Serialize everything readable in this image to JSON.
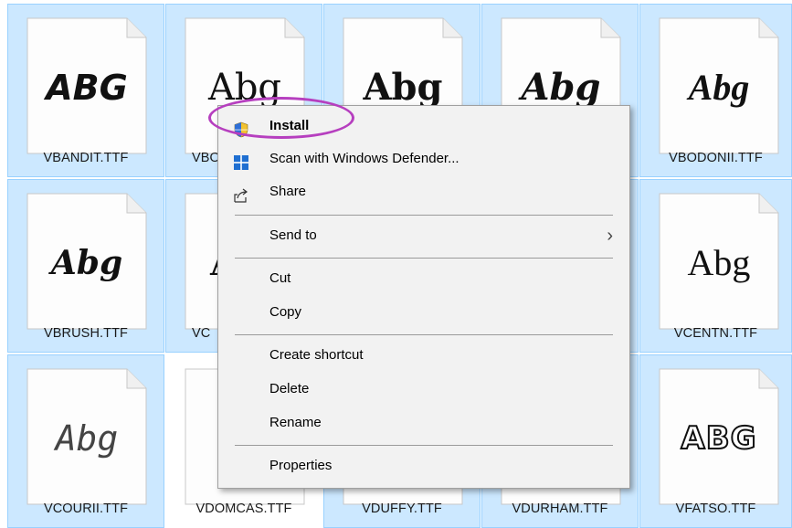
{
  "files": [
    {
      "name": "VBANDIT.TTF",
      "sample": "ABG",
      "selected": true
    },
    {
      "name": "VBO",
      "sample": "Abg",
      "selected": true
    },
    {
      "name": "",
      "sample": "Abg",
      "selected": true
    },
    {
      "name": "",
      "sample": "Abg",
      "selected": true
    },
    {
      "name": "VBODONII.TTF",
      "sample": "Abg",
      "selected": true
    },
    {
      "name": "VBRUSH.TTF",
      "sample": "Abg",
      "selected": true
    },
    {
      "name": "VC",
      "sample": "A",
      "selected": true
    },
    {
      "name": "",
      "sample": "",
      "selected": true
    },
    {
      "name": "",
      "sample": "",
      "selected": true
    },
    {
      "name": "VCENTN.TTF",
      "sample": "Abg",
      "selected": true
    },
    {
      "name": "VCOURII.TTF",
      "sample": "Abg",
      "selected": true
    },
    {
      "name": "VDOMCAS.TTF",
      "sample": "",
      "selected": false
    },
    {
      "name": "VDUFFY.TTF",
      "sample": "",
      "selected": true
    },
    {
      "name": "VDURHAM.TTF",
      "sample": "",
      "selected": true
    },
    {
      "name": "VFATSO.TTF",
      "sample": "ABG",
      "selected": true
    }
  ],
  "menu": {
    "install": "Install",
    "scan": "Scan with Windows Defender...",
    "share": "Share",
    "send_to": "Send to",
    "cut": "Cut",
    "copy": "Copy",
    "create_shortcut": "Create shortcut",
    "delete": "Delete",
    "rename": "Rename",
    "properties": "Properties"
  },
  "icons": {
    "install": "shield-icon",
    "scan": "windows-defender-icon",
    "share": "share-icon",
    "send_to": "chevron-right-icon"
  },
  "colors": {
    "selection": "#cce8ff",
    "selection_border": "#99d1ff",
    "menu_bg": "#f2f2f2",
    "annotation_ring": "#b63fbf"
  }
}
